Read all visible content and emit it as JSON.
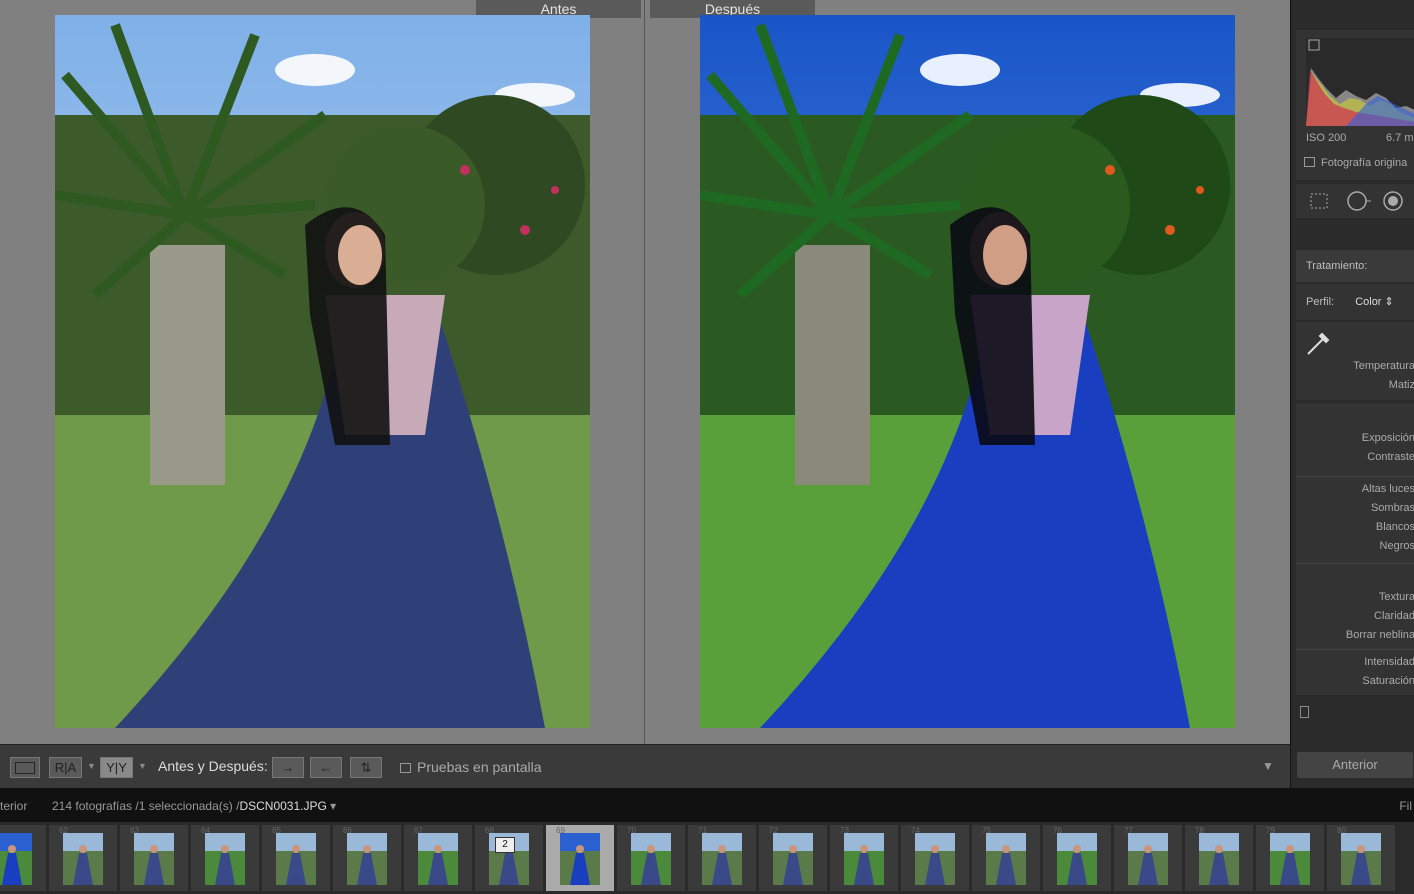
{
  "viewer": {
    "before_label": "Antes",
    "after_label": "Después"
  },
  "toolbar": {
    "view_loupe": "",
    "view_ra": "R|A",
    "view_yy": "Y|Y",
    "before_after_label": "Antes y Después:",
    "soft_proofing_label": "Pruebas en pantalla"
  },
  "right_panel": {
    "histogram": {
      "iso": "ISO 200",
      "shutter": "6.7 m",
      "original_photo": "Fotografía origina"
    },
    "basic": {
      "treatment_label": "Tratamiento:",
      "profile_label": "Perfil:",
      "profile_value": "Color",
      "wb_sliders": [
        "Temperatura",
        "Matiz"
      ],
      "tone_sliders": [
        "Exposición",
        "Contraste"
      ],
      "tone2_sliders": [
        "Altas luces",
        "Sombras",
        "Blancos",
        "Negros"
      ],
      "presence_sliders": [
        "Textura",
        "Claridad",
        "Borrar neblina"
      ],
      "color_sliders": [
        "Intensidad",
        "Saturación"
      ]
    },
    "previous_button": "Anterior"
  },
  "filmstrip_header": {
    "left_text": "terior",
    "info": "214 fotografías /1 seleccionada(s) /",
    "filename": "DSCN0031.JPG",
    "right_text": "Fil"
  },
  "filmstrip": {
    "numbers": [
      "61",
      "62",
      "63",
      "64",
      "65",
      "66",
      "67",
      "68",
      "69",
      "70",
      "71",
      "72",
      "73",
      "74",
      "75",
      "76",
      "77",
      "78",
      "79",
      "80"
    ],
    "badge": "2"
  },
  "colors": {
    "panel_bg": "#2b2b2b",
    "viewer_bg": "#808080",
    "selected_thumb": "#aaaaaa"
  }
}
